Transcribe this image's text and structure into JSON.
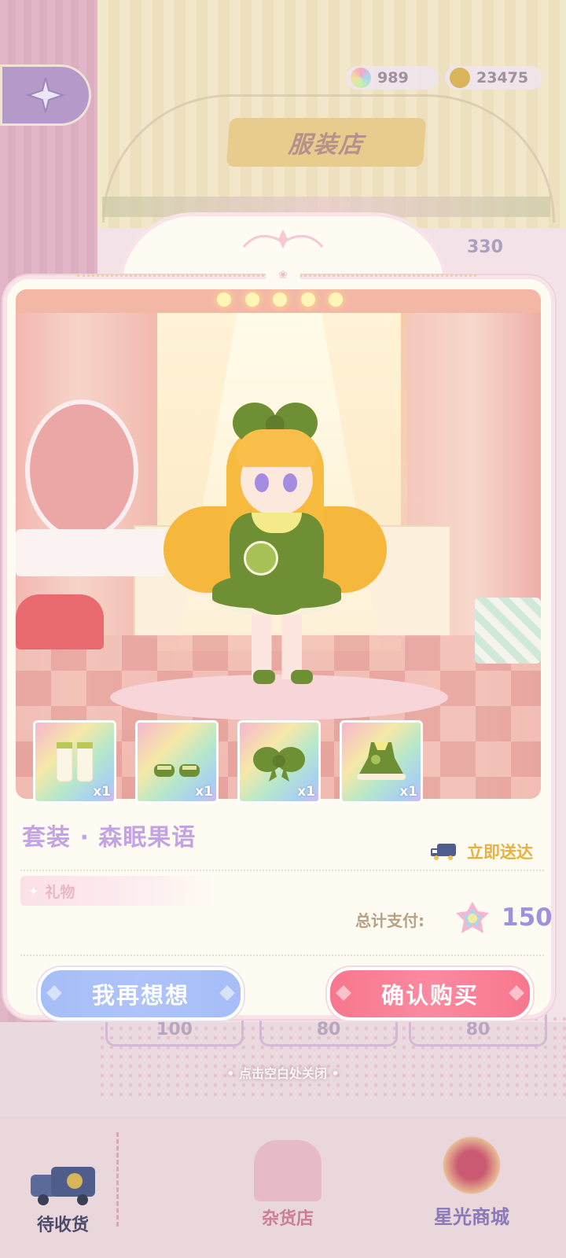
{
  "header": {
    "shop_title": "服装店",
    "currency": [
      {
        "name": "rainbow-gem",
        "value": "989"
      },
      {
        "name": "gold-coin",
        "value": "23475"
      }
    ]
  },
  "background": {
    "dim_prices": [
      "330",
      "100",
      "80",
      "80"
    ]
  },
  "dialog": {
    "items": [
      {
        "icon": "socks-icon",
        "qty": "x1"
      },
      {
        "icon": "shoes-icon",
        "qty": "x1"
      },
      {
        "icon": "hair-bow-icon",
        "qty": "x1"
      },
      {
        "icon": "dress-icon",
        "qty": "x1"
      }
    ],
    "outfit_name": "套装 · 森眠果语",
    "delivery_label": "立即送达",
    "tag_label": "礼物",
    "total_label": "总计支付:",
    "total_value": "150",
    "cancel_label": "我再想想",
    "confirm_label": "确认购买"
  },
  "close_hint": "• 点击空白处关闭 •",
  "nav": {
    "items": [
      {
        "label": "待收货",
        "icon": "delivery-truck-icon"
      },
      {
        "label": "杂货店",
        "icon": "store-icon"
      },
      {
        "label": "星光商城",
        "icon": "star-mall-icon"
      }
    ]
  },
  "colors": {
    "confirm": "#f7778e",
    "cancel": "#a6bdf7",
    "outfit_name": "#c3a3e3",
    "delivery": "#e6b142",
    "total_value": "#a290df"
  }
}
